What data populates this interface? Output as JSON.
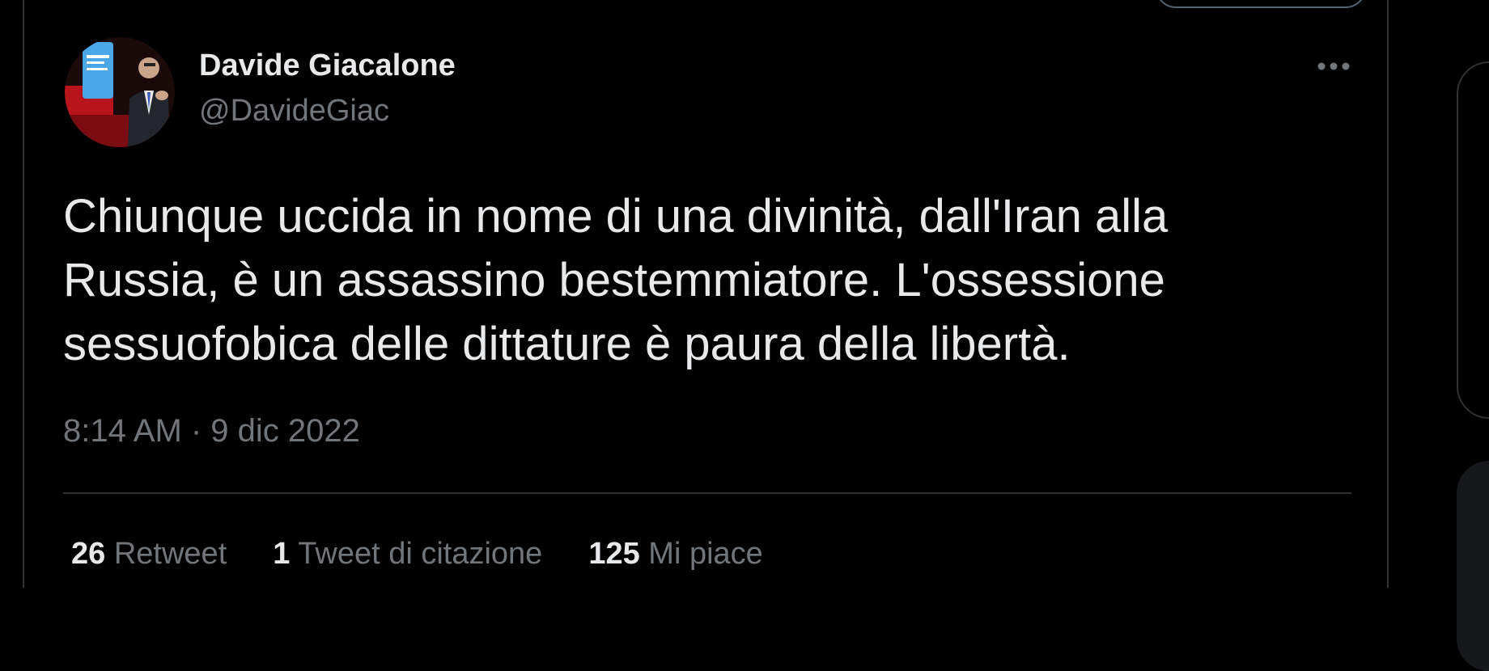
{
  "tweet": {
    "author": {
      "display_name": "Davide Giacalone",
      "handle": "@DavideGiac",
      "avatar_icon": "profile-photo"
    },
    "more_icon": "more-horizontal-icon",
    "text_lines": [
      "Chiunque uccida in nome di una divinità, dall'Iran alla",
      "Russia, è un assassino bestemmiatore. L'ossessione",
      "sessuofobica delle dittature è paura della libertà."
    ],
    "timestamp": "8:14 AM · 9 dic 2022",
    "stats": {
      "retweets": {
        "count": "26",
        "label": "Retweet"
      },
      "quotes": {
        "count": "1",
        "label": "Tweet di citazione"
      },
      "likes": {
        "count": "125",
        "label": "Mi piace"
      }
    }
  },
  "colors": {
    "background": "#000000",
    "text_primary": "#e7e9ea",
    "text_secondary": "#71767b",
    "border": "#2f3336"
  }
}
